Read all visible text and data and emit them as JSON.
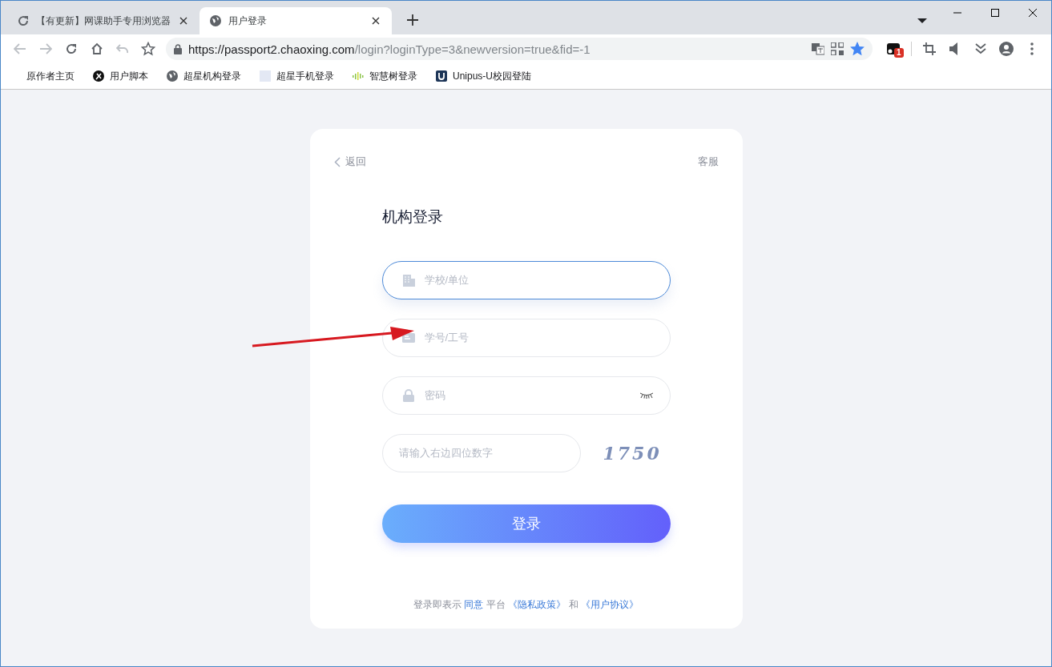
{
  "tabs": [
    {
      "title": "【有更新】网课助手专用浏览器",
      "kind": "reload",
      "selected": false
    },
    {
      "title": "用户登录",
      "kind": "globe",
      "selected": true
    }
  ],
  "address_bar": {
    "host": "https://passport2.chaoxing.com",
    "path": "/login?loginType=3&newversion=true&fid=-1",
    "starred": true
  },
  "extension_badge": "1",
  "bookmarks": [
    {
      "label": "原作者主页",
      "kind": "none"
    },
    {
      "label": "用户脚本",
      "kind": "script"
    },
    {
      "label": "超星机构登录",
      "kind": "globe"
    },
    {
      "label": "超星手机登录",
      "kind": "blank"
    },
    {
      "label": "智慧树登录",
      "kind": "bars"
    },
    {
      "label": "Unipus-U校园登陆",
      "kind": "u"
    }
  ],
  "login_card": {
    "back": "返回",
    "service": "客服",
    "title": "机构登录",
    "fields": [
      {
        "kind": "school",
        "placeholder": "学校/单位",
        "focused": true
      },
      {
        "kind": "id",
        "placeholder": "学号/工号",
        "focused": false
      },
      {
        "kind": "password",
        "placeholder": "密码",
        "focused": false
      }
    ],
    "captcha": {
      "placeholder": "请输入右边四位数字",
      "code": "1750"
    },
    "submit": "登录",
    "agreement": [
      {
        "text": "登录即表示",
        "kind": "text"
      },
      {
        "text": "同意",
        "kind": "link"
      },
      {
        "text": "平台",
        "kind": "text"
      },
      {
        "text": "《隐私政策》",
        "kind": "link"
      },
      {
        "text": "和",
        "kind": "text"
      },
      {
        "text": "《用户协议》",
        "kind": "link"
      }
    ]
  },
  "annotation": {
    "kind": "arrow"
  }
}
